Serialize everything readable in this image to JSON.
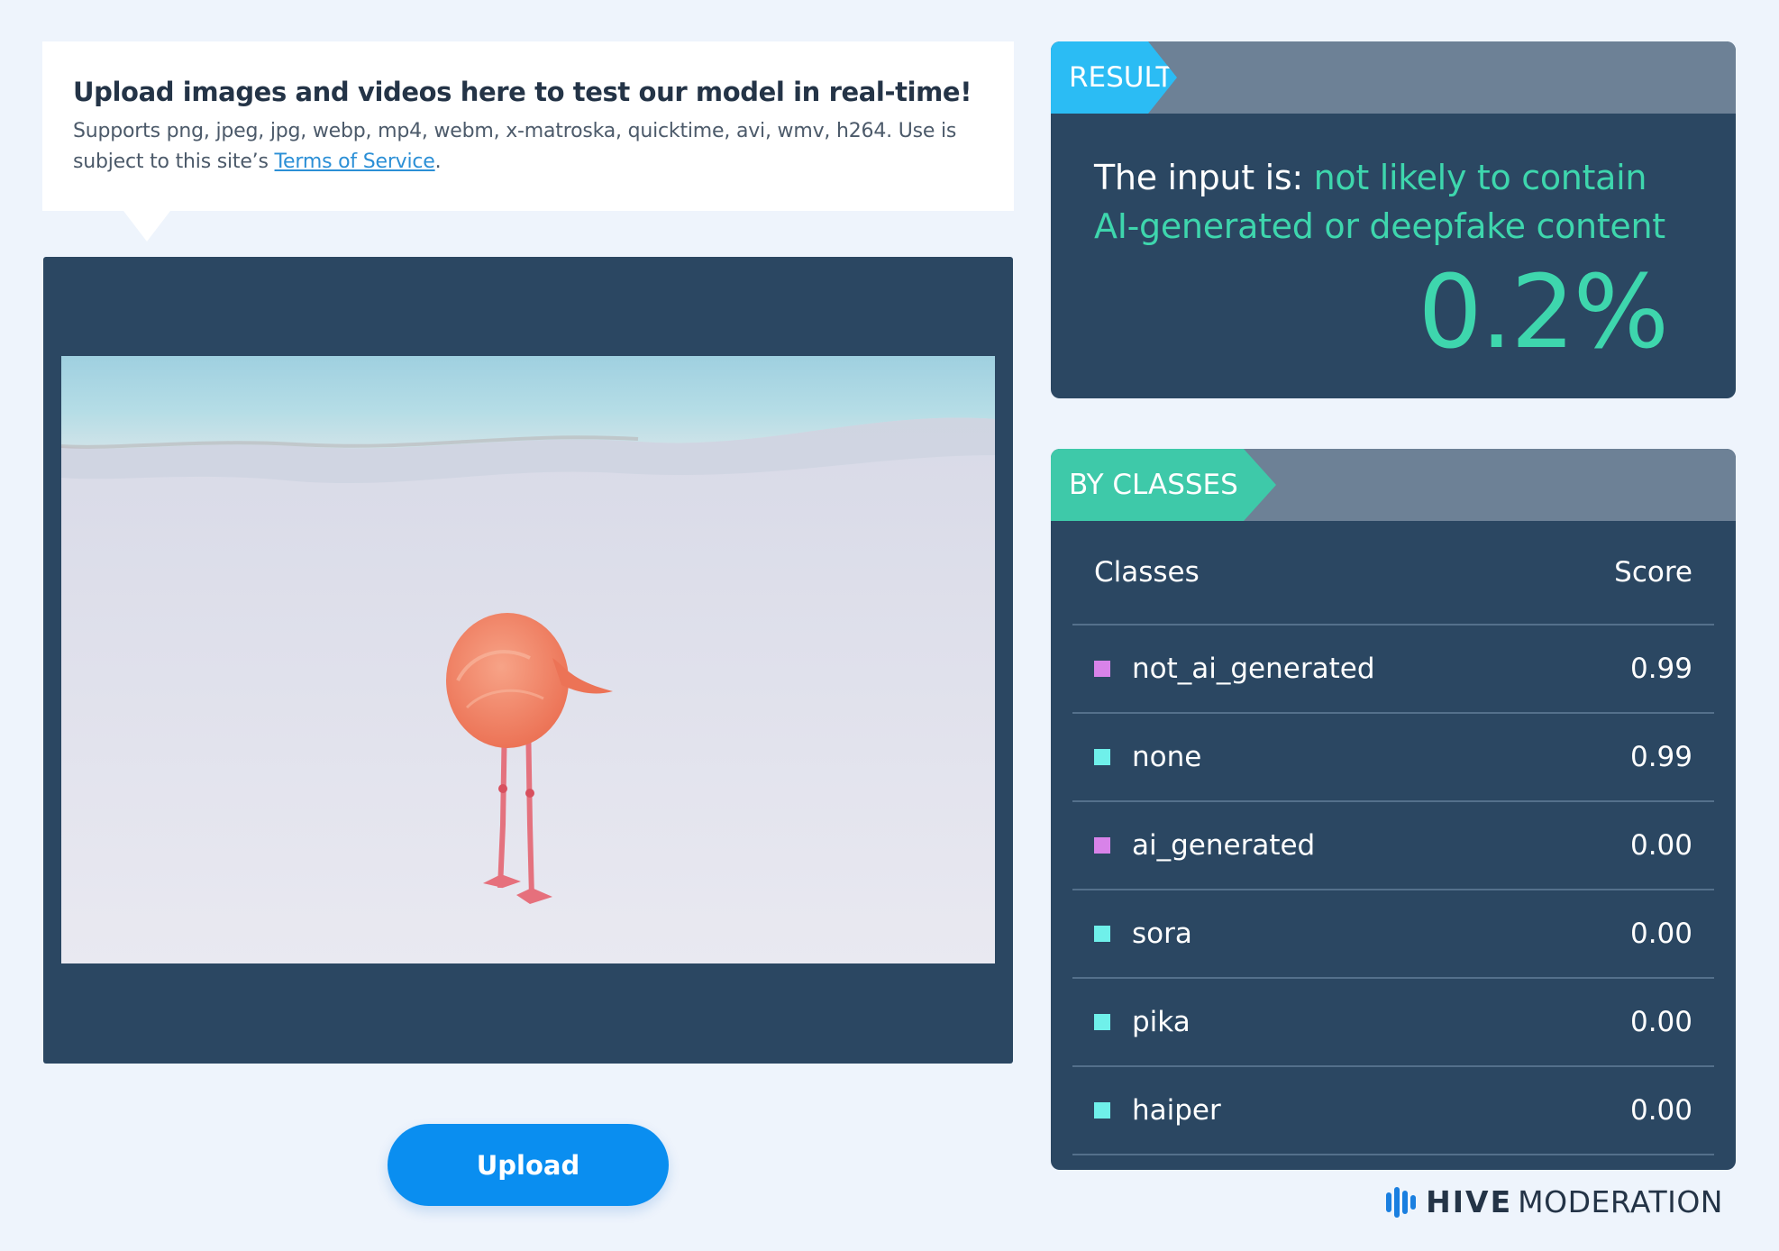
{
  "intro": {
    "title": "Upload images and videos here to test our model in real-time!",
    "desc_prefix": "Supports png, jpeg, jpg, webp, mp4, webm, x-matroska, quicktime, avi, wmv, h264. Use is subject to this site’s ",
    "terms_link": "Terms of Service",
    "desc_suffix": "."
  },
  "upload": {
    "label": "Upload"
  },
  "result": {
    "tab_label": "RESULT",
    "prefix": "The input is: ",
    "verdict": "not likely to contain AI-generated or deepfake content",
    "score": "0.2%"
  },
  "classes": {
    "tab_label": "BY CLASSES",
    "col_class": "Classes",
    "col_score": "Score",
    "rows": [
      {
        "name": "not_ai_generated",
        "score": "0.99",
        "color": "#d883e9"
      },
      {
        "name": "none",
        "score": "0.99",
        "color": "#6ff0ea"
      },
      {
        "name": "ai_generated",
        "score": "0.00",
        "color": "#d883e9"
      },
      {
        "name": "sora",
        "score": "0.00",
        "color": "#6ff0ea"
      },
      {
        "name": "pika",
        "score": "0.00",
        "color": "#6ff0ea"
      },
      {
        "name": "haiper",
        "score": "0.00",
        "color": "#6ff0ea"
      }
    ]
  },
  "brand": {
    "name": "HIVE",
    "sub": "MODERATION"
  },
  "colors": {
    "panel": "#2b4762",
    "accent_blue": "#2bbcf4",
    "accent_green": "#3ec9a9",
    "upload_button": "#0a8ef0"
  }
}
